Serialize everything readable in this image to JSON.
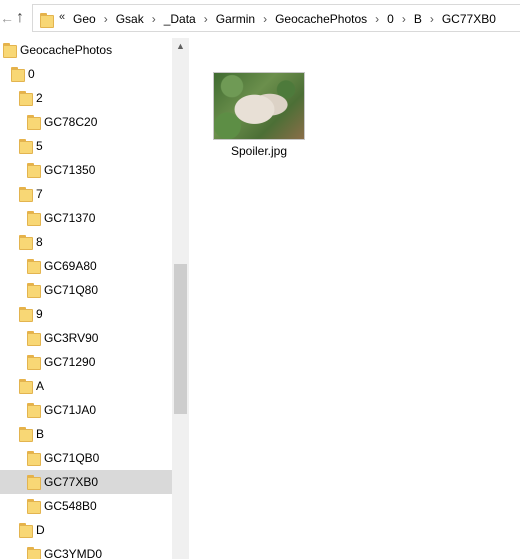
{
  "address_bar": {
    "overflow_chevron": "«",
    "breadcrumbs": [
      "Geo",
      "Gsak",
      "_Data",
      "Garmin",
      "GeocachePhotos",
      "0",
      "B",
      "GC77XB0"
    ],
    "separator": "›"
  },
  "tree": {
    "items": [
      {
        "label": "GeocachePhotos",
        "level": 0,
        "selected": false
      },
      {
        "label": "0",
        "level": 1,
        "selected": false
      },
      {
        "label": "2",
        "level": 2,
        "selected": false
      },
      {
        "label": "GC78C20",
        "level": 3,
        "selected": false
      },
      {
        "label": "5",
        "level": 2,
        "selected": false
      },
      {
        "label": "GC71350",
        "level": 3,
        "selected": false
      },
      {
        "label": "7",
        "level": 2,
        "selected": false
      },
      {
        "label": "GC71370",
        "level": 3,
        "selected": false
      },
      {
        "label": "8",
        "level": 2,
        "selected": false
      },
      {
        "label": "GC69A80",
        "level": 3,
        "selected": false
      },
      {
        "label": "GC71Q80",
        "level": 3,
        "selected": false
      },
      {
        "label": "9",
        "level": 2,
        "selected": false
      },
      {
        "label": "GC3RV90",
        "level": 3,
        "selected": false
      },
      {
        "label": "GC71290",
        "level": 3,
        "selected": false
      },
      {
        "label": "A",
        "level": 2,
        "selected": false
      },
      {
        "label": "GC71JA0",
        "level": 3,
        "selected": false
      },
      {
        "label": "B",
        "level": 2,
        "selected": false
      },
      {
        "label": "GC71QB0",
        "level": 3,
        "selected": false
      },
      {
        "label": "GC77XB0",
        "level": 3,
        "selected": true
      },
      {
        "label": "GC548B0",
        "level": 3,
        "selected": false
      },
      {
        "label": "D",
        "level": 2,
        "selected": false
      },
      {
        "label": "GC3YMD0",
        "level": 3,
        "selected": false
      }
    ]
  },
  "content": {
    "files": [
      {
        "name": "Spoiler.jpg",
        "icon": "image-thumbnail"
      }
    ]
  },
  "colors": {
    "folder": "#f8d775",
    "selection": "#d9d9d9",
    "scrollbar_thumb": "#cdcdcd"
  }
}
